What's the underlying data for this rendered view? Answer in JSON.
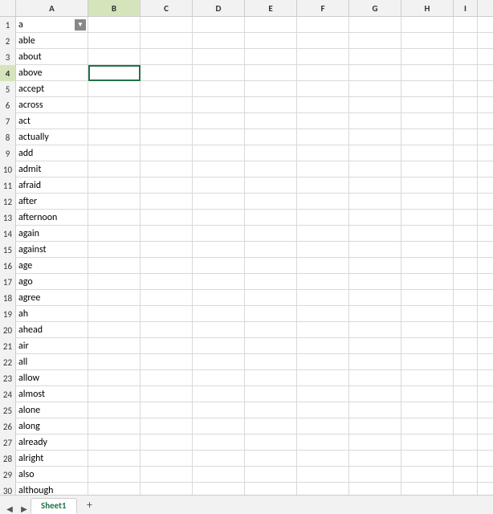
{
  "columns": [
    "",
    "A",
    "B",
    "C",
    "D",
    "E",
    "F",
    "G",
    "H",
    "I"
  ],
  "rows": [
    {
      "num": 1,
      "a": "a",
      "has_dropdown": true
    },
    {
      "num": 2,
      "a": "able"
    },
    {
      "num": 3,
      "a": "about"
    },
    {
      "num": 4,
      "a": "above",
      "selected_b": true
    },
    {
      "num": 5,
      "a": "accept"
    },
    {
      "num": 6,
      "a": "across"
    },
    {
      "num": 7,
      "a": "act"
    },
    {
      "num": 8,
      "a": "actually"
    },
    {
      "num": 9,
      "a": "add"
    },
    {
      "num": 10,
      "a": "admit"
    },
    {
      "num": 11,
      "a": "afraid"
    },
    {
      "num": 12,
      "a": "after"
    },
    {
      "num": 13,
      "a": "afternoon"
    },
    {
      "num": 14,
      "a": "again"
    },
    {
      "num": 15,
      "a": "against"
    },
    {
      "num": 16,
      "a": "age"
    },
    {
      "num": 17,
      "a": "ago"
    },
    {
      "num": 18,
      "a": "agree"
    },
    {
      "num": 19,
      "a": "ah"
    },
    {
      "num": 20,
      "a": "ahead"
    },
    {
      "num": 21,
      "a": "air"
    },
    {
      "num": 22,
      "a": "all"
    },
    {
      "num": 23,
      "a": "allow"
    },
    {
      "num": 24,
      "a": "almost"
    },
    {
      "num": 25,
      "a": "alone"
    },
    {
      "num": 26,
      "a": "along"
    },
    {
      "num": 27,
      "a": "already"
    },
    {
      "num": 28,
      "a": "alright"
    },
    {
      "num": 29,
      "a": "also"
    },
    {
      "num": 30,
      "a": "although"
    }
  ],
  "sheet_tabs": [
    {
      "label": "Sheet1",
      "active": true
    }
  ],
  "add_sheet_label": "+",
  "nav_left": "◀",
  "nav_right": "▶",
  "selected_cell": "B4",
  "colors": {
    "selected_border": "#217346",
    "header_bg": "#f2f2f2",
    "grid_line": "#d9d9d9",
    "row_num_bg": "#f2f2f2",
    "active_col_bg": "#d6e4bc"
  }
}
